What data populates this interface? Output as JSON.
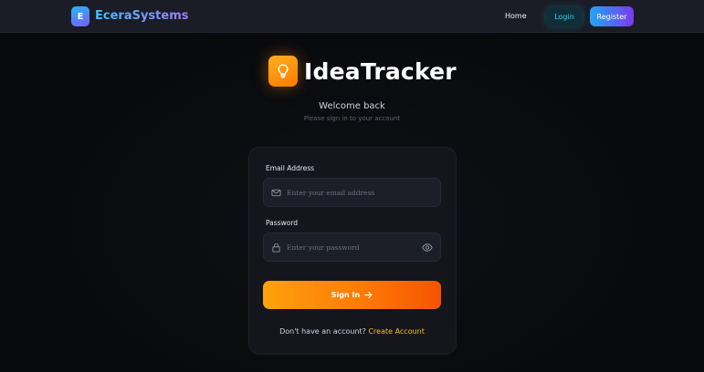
{
  "navbar": {
    "logo_letter": "E",
    "brand_name": "EceraSystems",
    "home_label": "Home",
    "login_label": "Login",
    "register_label": "Register"
  },
  "hero": {
    "app_title": "IdeaTracker",
    "icon": "lightbulb-icon",
    "welcome": "Welcome back",
    "subtitle": "Please sign in to your account"
  },
  "form": {
    "email_label": "Email Address",
    "email_placeholder": "Enter your email address",
    "email_icon": "mail-icon",
    "password_label": "Password",
    "password_placeholder": "Enter your password",
    "password_icon": "lock-icon",
    "toggle_icon": "eye-icon",
    "signin_label": "Sign In",
    "signin_icon": "arrow-right-icon",
    "no_account_text": "Don't have an account?",
    "create_account_label": "Create Account"
  },
  "colors": {
    "brand_gradient_start": "#22b8f0",
    "brand_gradient_end": "#7b5cff",
    "accent_orange": "#ff7a00",
    "link_yellow": "#fbbf24",
    "login_cyan": "#22d3ee"
  }
}
